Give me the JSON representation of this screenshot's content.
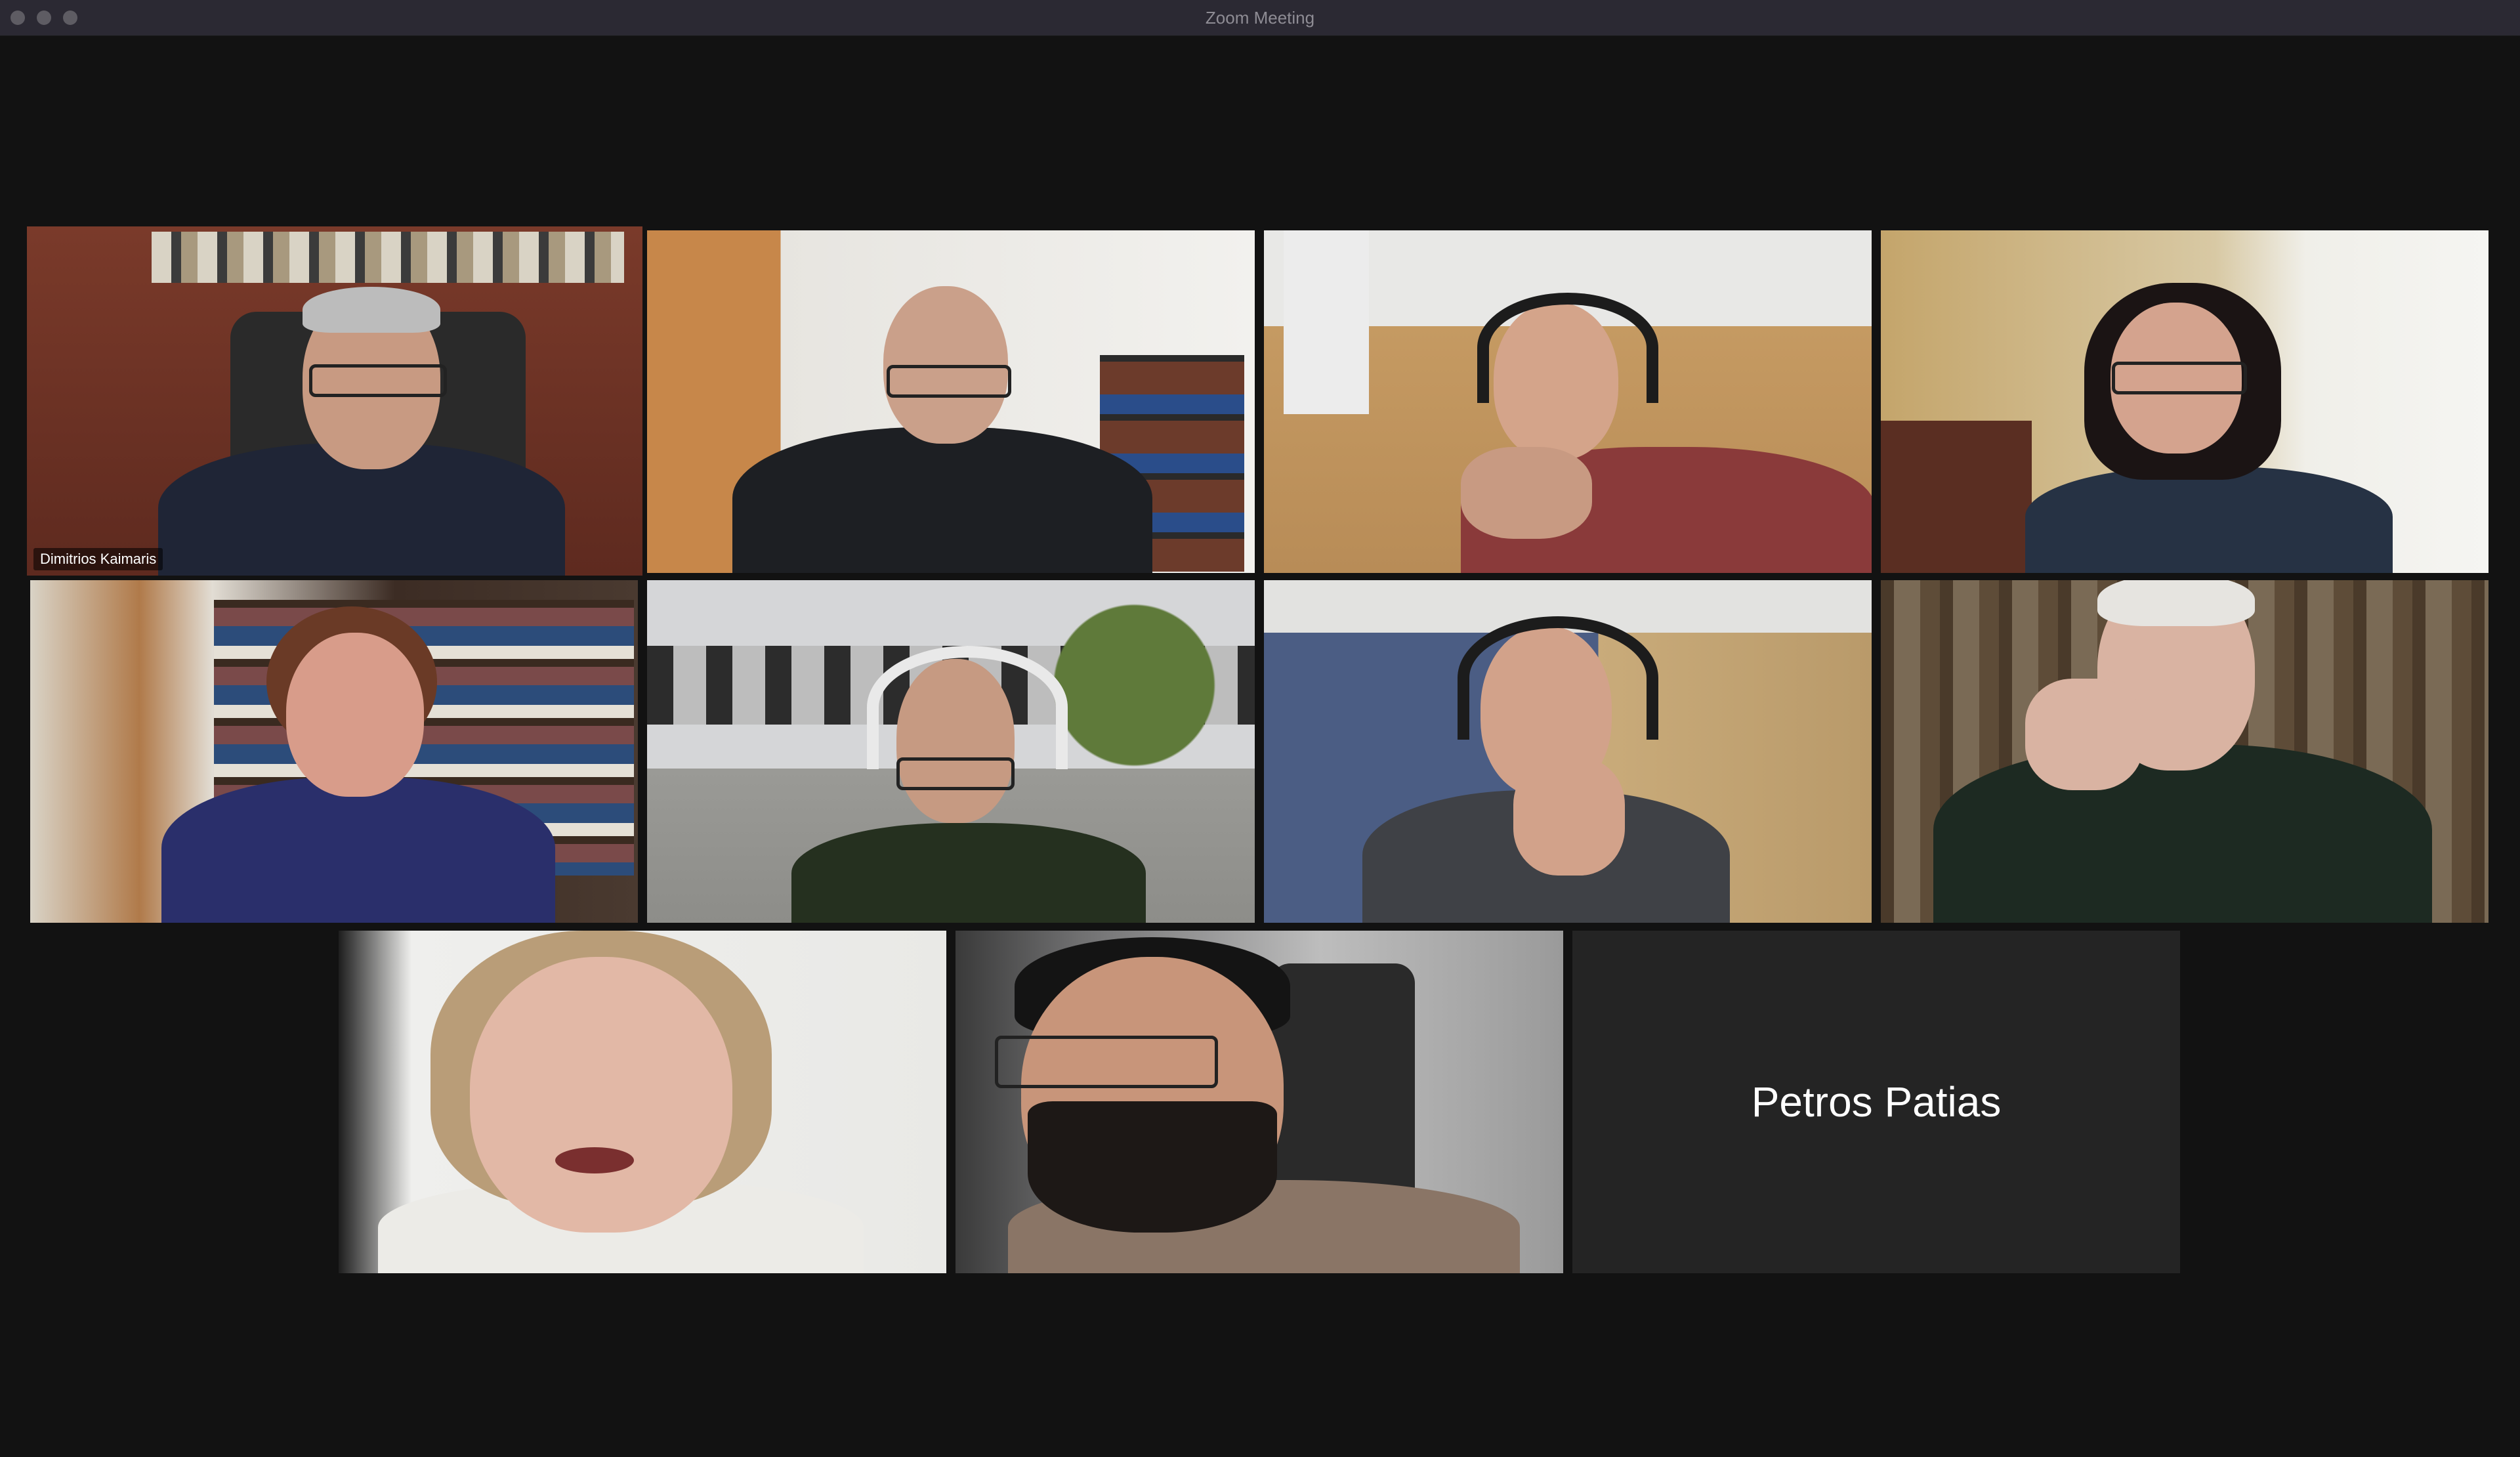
{
  "window": {
    "title": "Zoom Meeting"
  },
  "participants": [
    {
      "name": "Dimitrios Kaimaris",
      "video": true,
      "active_speaker": true
    },
    {
      "video": true
    },
    {
      "video": true
    },
    {
      "video": true
    },
    {
      "video": true
    },
    {
      "video": true
    },
    {
      "video": true
    },
    {
      "video": true
    },
    {
      "video": true
    },
    {
      "video": true
    },
    {
      "name": "Petros Patias",
      "video": false
    }
  ],
  "colors": {
    "active_speaker_border": "#e3e87a",
    "background": "#121212",
    "titlebar": "#2b2933",
    "no_video_tile": "#242424"
  }
}
